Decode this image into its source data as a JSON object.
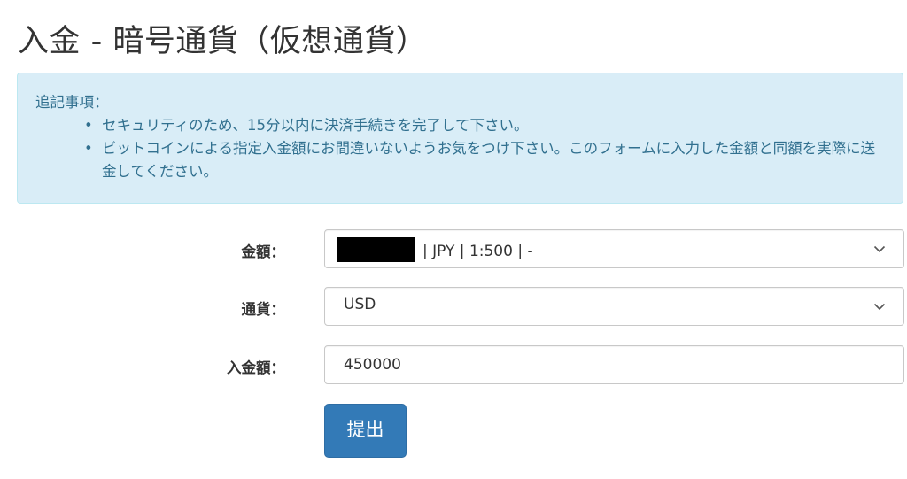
{
  "page": {
    "title": "入金 - 暗号通貨（仮想通貨）"
  },
  "notice": {
    "heading": "追記事項：",
    "bullet": "•",
    "items": [
      "セキュリティのため、15分以内に決済手続きを完了して下さい。",
      "ビットコインによる指定入金額にお間違いないようお気をつけ下さい。このフォームに入力した金額と同額を実際に送金してください。"
    ]
  },
  "form": {
    "account": {
      "label": "金額：",
      "value": "| JPY | 1:500 | -",
      "redacted": true
    },
    "currency": {
      "label": "通貨：",
      "value": "USD"
    },
    "amount": {
      "label": "入金額：",
      "value": "450000"
    },
    "submit_label": "提出"
  },
  "colors": {
    "alert_bg": "#d9edf7",
    "alert_text": "#31708f",
    "primary_button": "#337ab7"
  },
  "icons": {
    "select_arrow": "chevron-down-icon"
  }
}
